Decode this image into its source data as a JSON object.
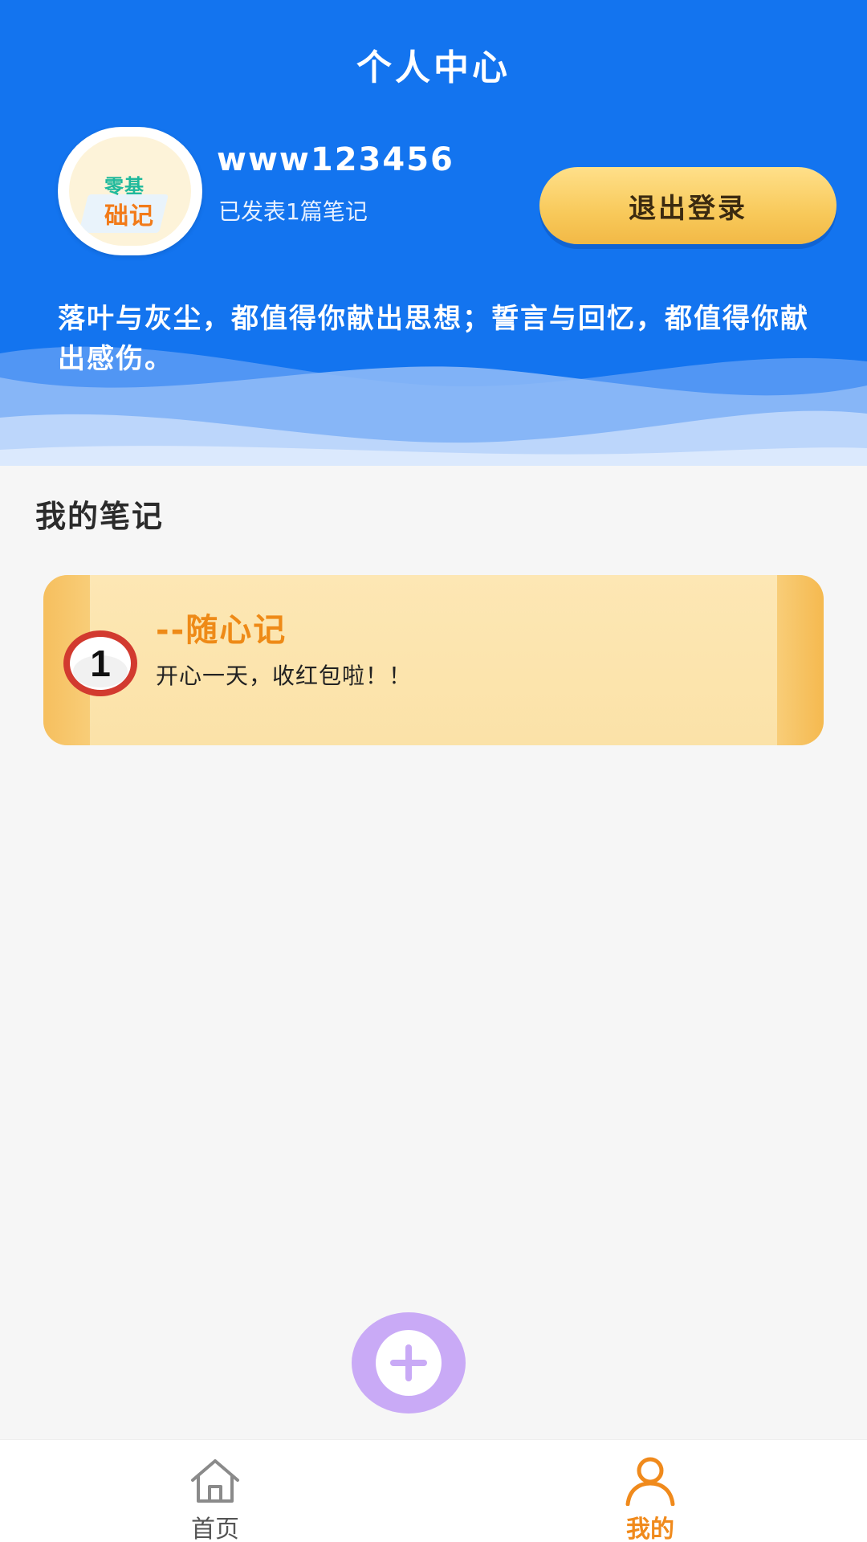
{
  "header": {
    "title": "个人中心",
    "motto": "落叶与灰尘，都值得你献出思想；誓言与回忆，都值得你献出感伤。"
  },
  "profile": {
    "avatar_text_1": "零基",
    "avatar_text_2": "础记",
    "username": "www123456",
    "post_count": "已发表1篇笔记",
    "logout_label": "退出登录"
  },
  "notes": {
    "section_title": "我的笔记",
    "items": [
      {
        "badge": "1",
        "title": "--随心记",
        "content": "开心一天，收红包啦！！"
      }
    ]
  },
  "fab": {
    "icon": "plus-icon"
  },
  "nav": {
    "items": [
      {
        "label": "首页",
        "icon": "home-icon"
      },
      {
        "label": "我的",
        "icon": "user-icon"
      }
    ]
  },
  "colors": {
    "header_blue": "#1374ef",
    "accent_orange": "#f08a1c",
    "logout_gold": "#f8c95a",
    "fab_purple": "#c9aaf6",
    "note_paper": "#fde7b4"
  }
}
